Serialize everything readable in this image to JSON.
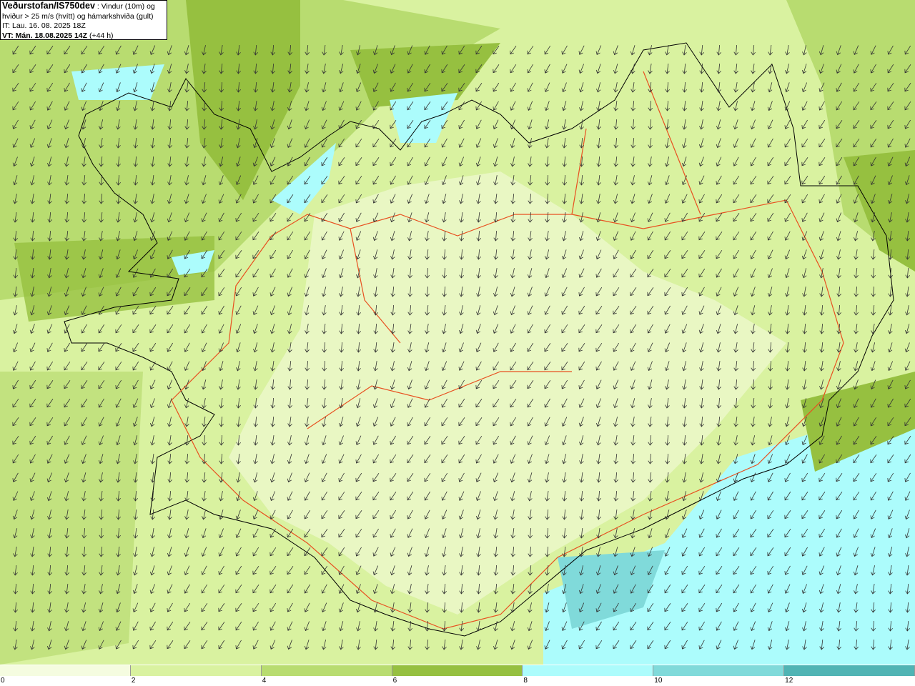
{
  "title": {
    "source": "Veðurstofan/IS750dev",
    "description": " : Vindur (10m) og hviður > 25 m/s (hvítt) og hámarkshviða (gult)",
    "initial_time": "IT: Lau. 16. 08. 2025 18Z",
    "valid_label": "VT: Mán. 18.08.2025 14Z",
    "lead_time": " (+44 h)"
  },
  "map": {
    "region": "Iceland",
    "layers": [
      "wind speed shading (10m)",
      "wind direction arrows",
      "coastline",
      "roads"
    ],
    "dominant_wind_direction": "northeast to north (arrows pointing south-southwest)",
    "colors": {
      "coast": "#000000",
      "roads": "#e85020"
    }
  },
  "legend": {
    "ticks": [
      "0",
      "2",
      "4",
      "6",
      "8",
      "10",
      "12"
    ],
    "bins": [
      {
        "from": 0,
        "to": 2,
        "color": "#f5fce0"
      },
      {
        "from": 2,
        "to": 4,
        "color": "#d9f2a0"
      },
      {
        "from": 4,
        "to": 6,
        "color": "#b8dc70"
      },
      {
        "from": 6,
        "to": 8,
        "color": "#96c040"
      },
      {
        "from": 8,
        "to": 10,
        "color": "#acfcfc"
      },
      {
        "from": 10,
        "to": 12,
        "color": "#80dada"
      },
      {
        "from": 12,
        "to": 14,
        "color": "#50b4b4"
      }
    ]
  }
}
